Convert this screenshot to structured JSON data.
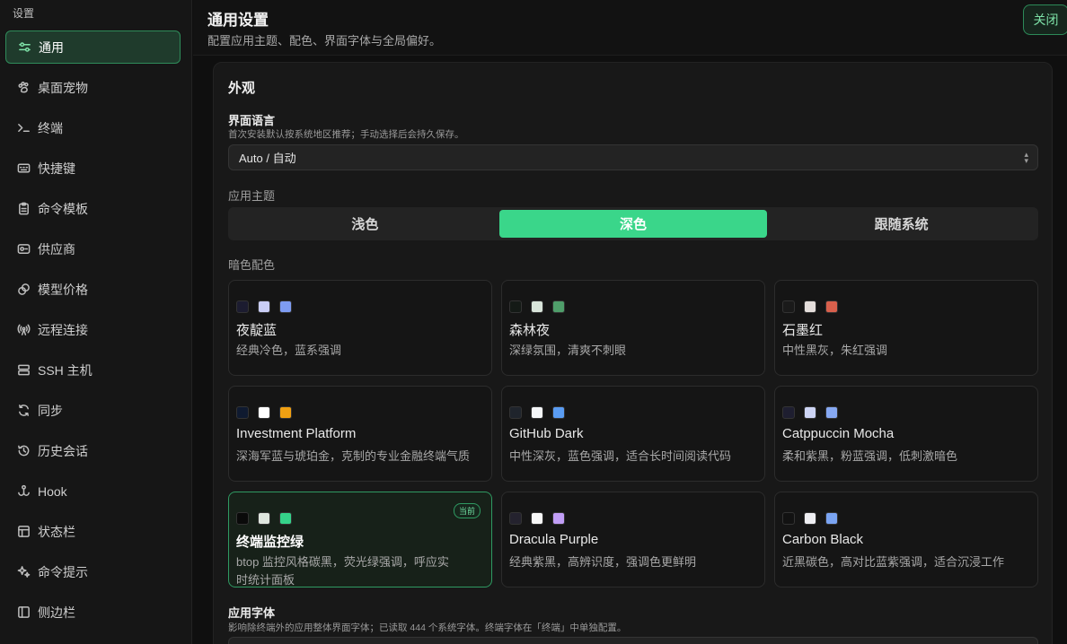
{
  "sidebar": {
    "title": "设置",
    "items": [
      {
        "label": "通用",
        "icon": "sliders-icon",
        "active": true
      },
      {
        "label": "桌面宠物",
        "icon": "paw-icon"
      },
      {
        "label": "终端",
        "icon": "terminal-icon"
      },
      {
        "label": "快捷键",
        "icon": "keyboard-icon"
      },
      {
        "label": "命令模板",
        "icon": "clipboard-icon"
      },
      {
        "label": "供应商",
        "icon": "provider-icon"
      },
      {
        "label": "模型价格",
        "icon": "coins-icon"
      },
      {
        "label": "远程连接",
        "icon": "radio-icon"
      },
      {
        "label": "SSH 主机",
        "icon": "server-icon"
      },
      {
        "label": "同步",
        "icon": "sync-icon"
      },
      {
        "label": "历史会话",
        "icon": "history-icon"
      },
      {
        "label": "Hook",
        "icon": "hook-icon"
      },
      {
        "label": "状态栏",
        "icon": "layout-icon"
      },
      {
        "label": "命令提示",
        "icon": "sparkle-icon"
      },
      {
        "label": "侧边栏",
        "icon": "sidebar-icon"
      }
    ]
  },
  "header": {
    "title": "通用设置",
    "subtitle": "配置应用主题、配色、界面字体与全局偏好。",
    "close_label": "关闭"
  },
  "appearance": {
    "section_title": "外观",
    "language": {
      "label": "界面语言",
      "hint": "首次安装默认按系统地区推荐；手动选择后会持久保存。",
      "value": "Auto / 自动"
    },
    "theme": {
      "label": "应用主题",
      "options": [
        "浅色",
        "深色",
        "跟随系统"
      ],
      "selected": "深色"
    },
    "dark_scheme": {
      "label": "暗色配色",
      "current_badge": "当前",
      "schemes": [
        {
          "name": "夜靛蓝",
          "desc": "经典冷色，蓝系强调",
          "colors": [
            "#1c1c30",
            "#c9cdf5",
            "#7e9cf2"
          ]
        },
        {
          "name": "森林夜",
          "desc": "深绿氛围，清爽不刺眼",
          "colors": [
            "#141a16",
            "#d8e4da",
            "#4f9e6a"
          ]
        },
        {
          "name": "石墨红",
          "desc": "中性黑灰，朱红强调",
          "colors": [
            "#1a1a1a",
            "#e4dedb",
            "#d8604c"
          ]
        },
        {
          "name": "Investment Platform",
          "desc": "深海军蓝与琥珀金，克制的专业金融终端气质",
          "colors": [
            "#0f1a30",
            "#ffffff",
            "#f0a012"
          ]
        },
        {
          "name": "GitHub Dark",
          "desc": "中性深灰，蓝色强调，适合长时间阅读代码",
          "colors": [
            "#1f242c",
            "#f4f6f8",
            "#5a9cf2"
          ]
        },
        {
          "name": "Catppuccin Mocha",
          "desc": "柔和紫黑，粉蓝强调，低刺激暗色",
          "colors": [
            "#1e1e30",
            "#cdd4f4",
            "#86a8f2"
          ]
        },
        {
          "name": "终端监控绿",
          "desc": "btop 监控风格碳黑，荧光绿强调，呼应实时统计面板",
          "colors": [
            "#0a0a0a",
            "#dfe6df",
            "#35d38a"
          ],
          "current": true
        },
        {
          "name": "Dracula Purple",
          "desc": "经典紫黑，高辨识度，强调色更鲜明",
          "colors": [
            "#24222e",
            "#f7f7f7",
            "#c19ef6"
          ]
        },
        {
          "name": "Carbon Black",
          "desc": "近黑碳色，高对比蓝紫强调，适合沉浸工作",
          "colors": [
            "#121212",
            "#eeeef2",
            "#7aa4f2"
          ]
        }
      ]
    },
    "font": {
      "label": "应用字体",
      "hint": "影响除终端外的应用整体界面字体；已读取 444 个系统字体。终端字体在「终端」中单独配置。"
    }
  }
}
